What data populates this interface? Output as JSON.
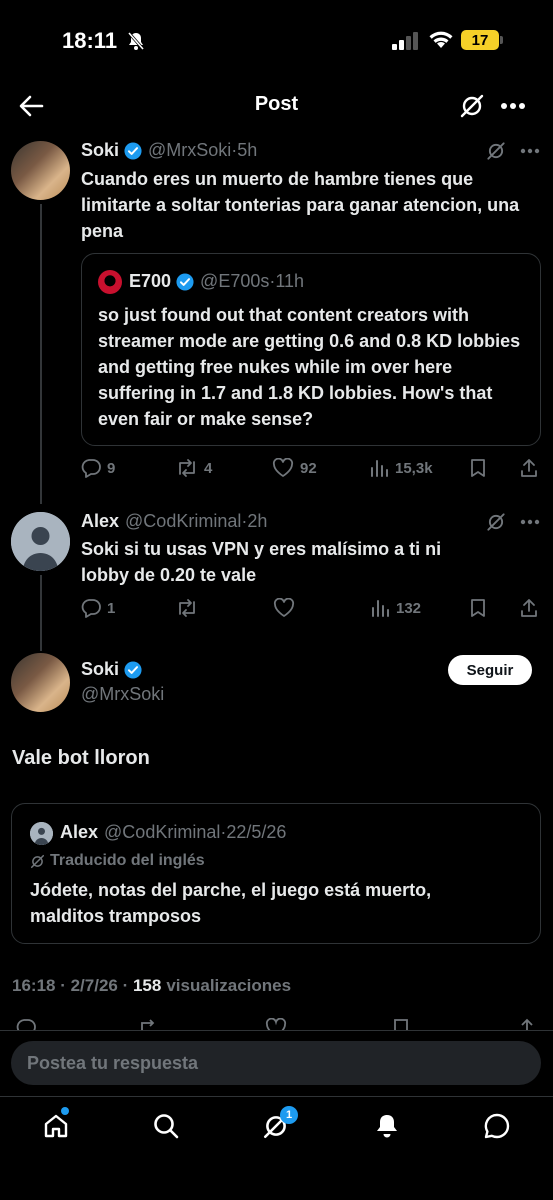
{
  "status_bar": {
    "time": "18:11",
    "battery": "17"
  },
  "header": {
    "title": "Post"
  },
  "thread": [
    {
      "name": "Soki",
      "handle": "@MrxSoki",
      "time": "5h",
      "text": "Cuando eres un muerto de hambre tienes que limitarte a soltar tonterias para ganar atencion, una pena",
      "quote": {
        "name": "E700",
        "handle": "@E700s",
        "time": "11h",
        "text": "so just found out that content creators with streamer mode are getting 0.6 and 0.8 KD lobbies and getting free nukes while im over here suffering in 1.7 and 1.8 KD lobbies. How's that even fair or make sense?"
      },
      "actions": {
        "replies": "9",
        "reposts": "4",
        "likes": "92",
        "views": "15,3k"
      }
    },
    {
      "name": "Alex",
      "handle": "@CodKriminal",
      "time": "2h",
      "text": "Soki si tu usas VPN y eres malísimo a ti ni lobby de 0.20 te vale",
      "actions": {
        "replies": "1",
        "views": "132"
      }
    }
  ],
  "main_post": {
    "name": "Soki",
    "handle": "@MrxSoki",
    "follow_label": "Seguir",
    "text": "Vale bot lloron",
    "quote": {
      "name": "Alex",
      "handle": "@CodKriminal",
      "date": "22/5/26",
      "translated_label": "Traducido del inglés",
      "text": "Jódete, notas del parche, el juego está muerto, malditos tramposos"
    },
    "meta": {
      "time": "16:18",
      "date": "2/7/26",
      "views": "158",
      "views_label": "visualizaciones"
    }
  },
  "reply_bar": {
    "placeholder": "Postea tu respuesta"
  },
  "tab_bar": {
    "grok_badge": "1"
  },
  "colors": {
    "accent": "#1d9bf0",
    "background": "#000000",
    "text": "#e7e9ea",
    "secondary": "#71767b"
  }
}
